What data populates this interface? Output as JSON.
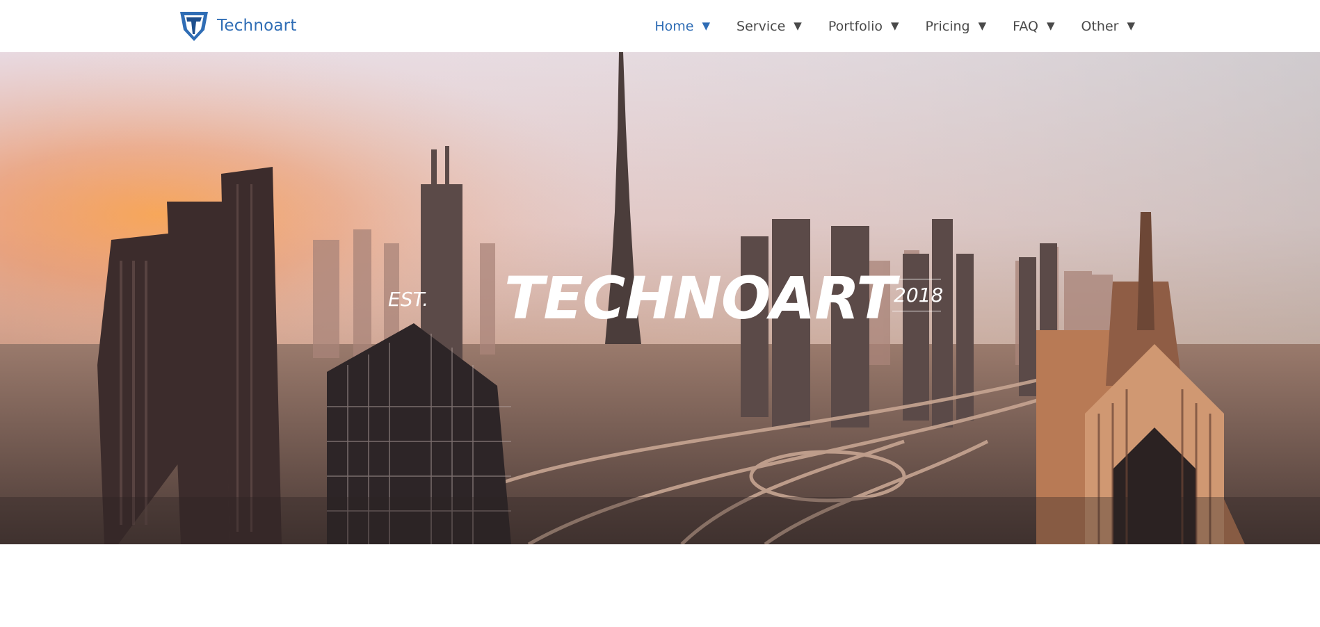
{
  "brand": {
    "name": "Technoart",
    "color": "#2f6db5"
  },
  "nav": {
    "items": [
      {
        "label": "Home",
        "active": true
      },
      {
        "label": "Service"
      },
      {
        "label": "Portfolio"
      },
      {
        "label": "Pricing"
      },
      {
        "label": "FAQ"
      },
      {
        "label": "Other"
      }
    ],
    "caret": "▼"
  },
  "hero": {
    "prefix": "EST.",
    "title": "TECHNOART",
    "year": "2018",
    "image": "city-skyline-at-sunset"
  }
}
